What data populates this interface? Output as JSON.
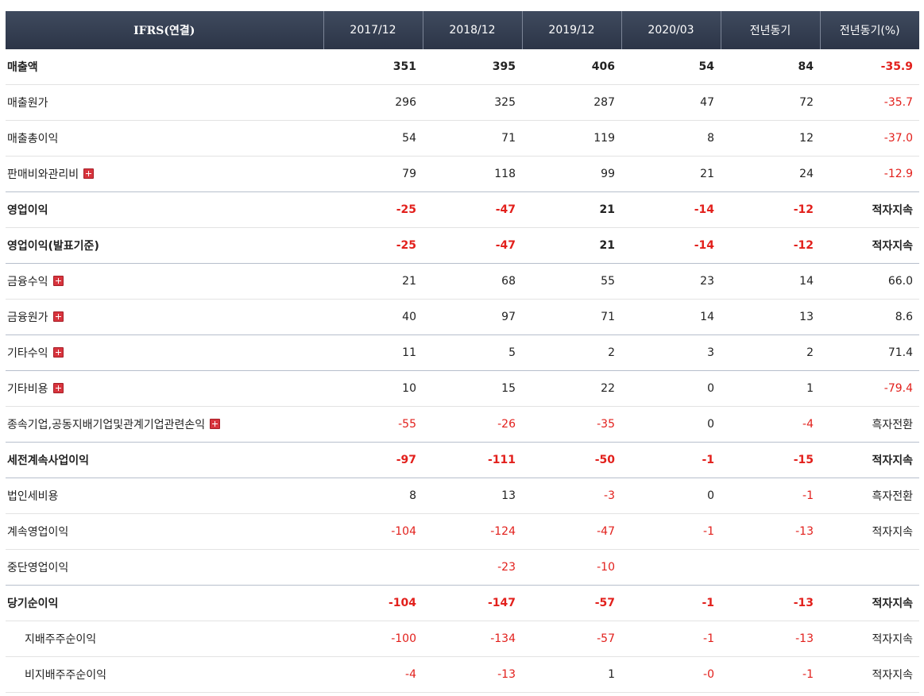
{
  "header": {
    "label_col": "IFRS(연결)",
    "cols": [
      "2017/12",
      "2018/12",
      "2019/12",
      "2020/03",
      "전년동기",
      "전년동기(%)"
    ]
  },
  "rows": [
    {
      "label": "매출액",
      "bold": true,
      "values": [
        "351",
        "395",
        "406",
        "54",
        "84",
        "-35.9"
      ]
    },
    {
      "label": "매출원가",
      "values": [
        "296",
        "325",
        "287",
        "47",
        "72",
        "-35.7"
      ]
    },
    {
      "label": "매출총이익",
      "values": [
        "54",
        "71",
        "119",
        "8",
        "12",
        "-37.0"
      ]
    },
    {
      "label": "판매비와관리비",
      "expand": true,
      "values": [
        "79",
        "118",
        "99",
        "21",
        "24",
        "-12.9"
      ]
    },
    {
      "label": "영업이익",
      "bold": true,
      "values": [
        "-25",
        "-47",
        "21",
        "-14",
        "-12",
        "적자지속"
      ]
    },
    {
      "label": "영업이익(발표기준)",
      "bold": true,
      "values": [
        "-25",
        "-47",
        "21",
        "-14",
        "-12",
        "적자지속"
      ]
    },
    {
      "label": "금융수익",
      "expand": true,
      "values": [
        "21",
        "68",
        "55",
        "23",
        "14",
        "66.0"
      ]
    },
    {
      "label": "금융원가",
      "expand": true,
      "values": [
        "40",
        "97",
        "71",
        "14",
        "13",
        "8.6"
      ]
    },
    {
      "label": "기타수익",
      "expand": true,
      "values": [
        "11",
        "5",
        "2",
        "3",
        "2",
        "71.4"
      ]
    },
    {
      "label": "기타비용",
      "expand": true,
      "values": [
        "10",
        "15",
        "22",
        "0",
        "1",
        "-79.4"
      ]
    },
    {
      "label": "종속기업,공동지배기업및관계기업관련손익",
      "expand": true,
      "values": [
        "-55",
        "-26",
        "-35",
        "0",
        "-4",
        "흑자전환"
      ]
    },
    {
      "label": "세전계속사업이익",
      "bold": true,
      "values": [
        "-97",
        "-111",
        "-50",
        "-1",
        "-15",
        "적자지속"
      ]
    },
    {
      "label": "법인세비용",
      "values": [
        "8",
        "13",
        "-3",
        "0",
        "-1",
        "흑자전환"
      ]
    },
    {
      "label": "계속영업이익",
      "values": [
        "-104",
        "-124",
        "-47",
        "-1",
        "-13",
        "적자지속"
      ]
    },
    {
      "label": "중단영업이익",
      "values": [
        "",
        "-23",
        "-10",
        "",
        "",
        ""
      ]
    },
    {
      "label": "당기순이익",
      "bold": true,
      "values": [
        "-104",
        "-147",
        "-57",
        "-1",
        "-13",
        "적자지속"
      ]
    },
    {
      "label": "지배주주순이익",
      "sub": true,
      "values": [
        "-100",
        "-134",
        "-57",
        "-1",
        "-13",
        "적자지속"
      ]
    },
    {
      "label": "비지배주주순이익",
      "sub": true,
      "values": [
        "-4",
        "-13",
        "1",
        "-0",
        "-1",
        "적자지속"
      ]
    }
  ],
  "colors": {
    "negative": "#e2201c",
    "header_bg": "#333c4f",
    "expand_icon": "#d8343d"
  }
}
